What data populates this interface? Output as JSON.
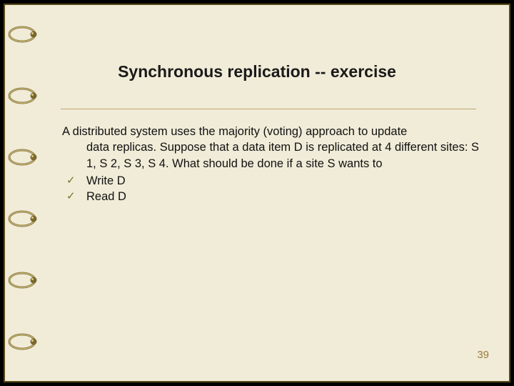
{
  "slide": {
    "title": "Synchronous replication -- exercise",
    "intro_line1": "A distributed system uses the majority (voting) approach to update",
    "intro_cont": "data replicas. Suppose that a data item D is replicated at 4 different sites: S 1, S 2, S 3, S 4. What should be done if a site S wants to",
    "bullets": [
      {
        "text": "Write D"
      },
      {
        "text": "Read D"
      }
    ],
    "page_number": "39",
    "check_glyph": "✓"
  },
  "colors": {
    "background": "#f1ecd8",
    "border": "#5a4a1a",
    "rule": "#b8a870",
    "check": "#6a7a2a",
    "pagenum": "#9a7b3a"
  }
}
